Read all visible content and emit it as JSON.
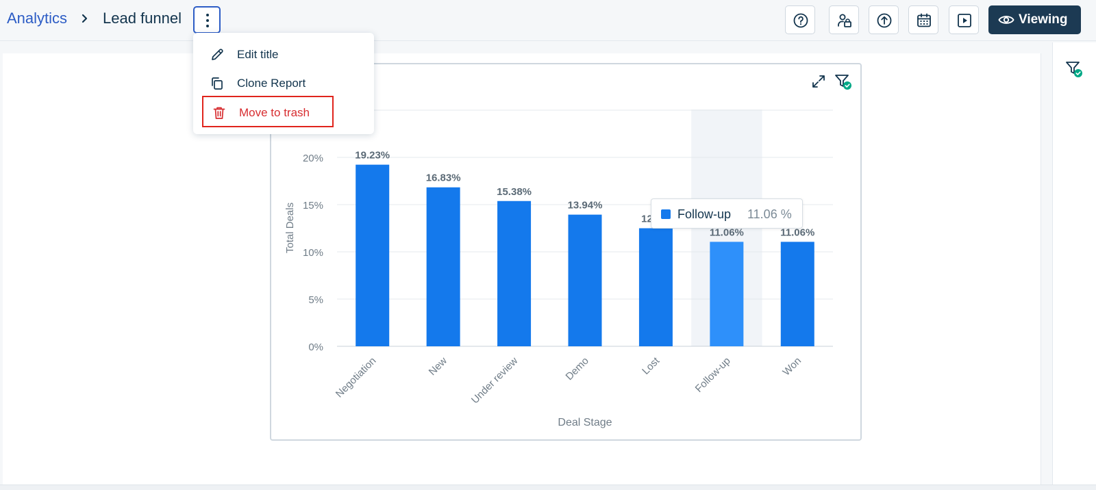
{
  "breadcrumb": {
    "root": "Analytics",
    "current": "Lead funnel"
  },
  "toolbar": {
    "buttons": [
      {
        "name": "help-button",
        "icon": "help-icon"
      },
      {
        "name": "share-button",
        "icon": "users-icon"
      },
      {
        "name": "export-button",
        "icon": "upload-icon"
      },
      {
        "name": "schedule-button",
        "icon": "calendar-icon"
      },
      {
        "name": "present-button",
        "icon": "play-icon"
      }
    ],
    "viewing_label": "Viewing"
  },
  "menu": {
    "items": [
      {
        "label": "Edit title",
        "icon": "pencil-icon"
      },
      {
        "label": "Clone Report",
        "icon": "copy-icon"
      },
      {
        "label": "Move to trash",
        "icon": "trash-icon"
      }
    ]
  },
  "tooltip": {
    "name": "Follow-up",
    "value": "11.06 %"
  },
  "colors": {
    "bar": "#1479ec",
    "bar_hover": "#2e90fa",
    "hover_band": "#f1f4f8",
    "accent": "#2c5cc5",
    "danger": "#d72d30",
    "success": "#00a886"
  },
  "chart_data": {
    "type": "bar",
    "categories": [
      "Negotiation",
      "New",
      "Under review",
      "Demo",
      "Lost",
      "Follow-up",
      "Won"
    ],
    "values": [
      19.23,
      16.83,
      15.38,
      13.94,
      12.5,
      11.06,
      11.06
    ],
    "data_labels": [
      "19.23%",
      "16.83%",
      "15.38%",
      "13.94%",
      "12.5%",
      "11.06%",
      "11.06%"
    ],
    "xlabel": "Deal Stage",
    "ylabel": "Total Deals",
    "yticks": [
      "0%",
      "5%",
      "10%",
      "15%",
      "20%"
    ],
    "ylim": [
      0,
      25
    ],
    "highlighted": "Follow-up",
    "grid": true
  }
}
